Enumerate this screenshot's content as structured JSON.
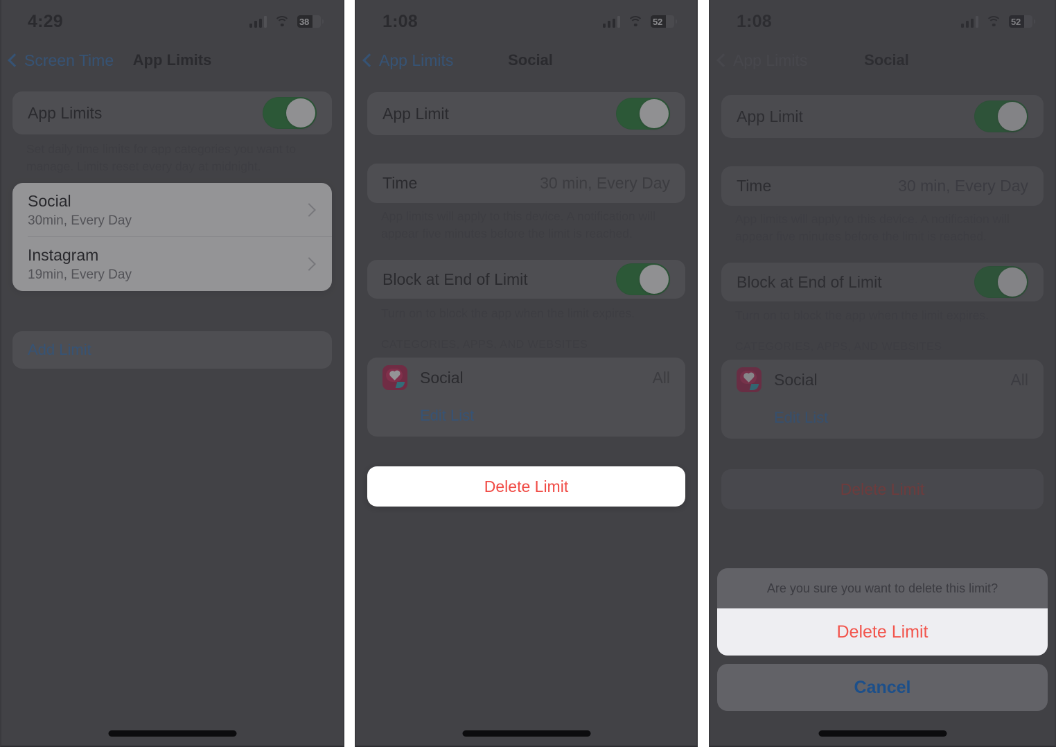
{
  "panels": [
    {
      "status": {
        "time": "4:29",
        "battery_level": "38",
        "signal_icon": "cellular-signal-icon",
        "wifi_icon": "wifi-icon",
        "battery_icon": "battery-icon"
      },
      "nav": {
        "back_label": "Screen Time",
        "title": "App Limits",
        "back_icon": "chevron-left-icon"
      },
      "app_limits_row": {
        "label": "App Limits",
        "toggle_on": true
      },
      "footnote": "Set daily time limits for app categories you want to manage. Limits reset every day at midnight.",
      "limits": [
        {
          "title": "Social",
          "subtitle": "30min, Every Day",
          "chevron_icon": "chevron-right-icon"
        },
        {
          "title": "Instagram",
          "subtitle": "19min, Every Day",
          "chevron_icon": "chevron-right-icon"
        }
      ],
      "add_limit_label": "Add Limit"
    },
    {
      "status": {
        "time": "1:08",
        "battery_level": "52"
      },
      "nav": {
        "back_label": "App Limits",
        "title": "Social"
      },
      "app_limit_row": {
        "label": "App Limit",
        "toggle_on": true
      },
      "time_row": {
        "label": "Time",
        "value": "30 min, Every Day"
      },
      "time_footnote": "App limits will apply to this device. A notification will appear five minutes before the limit is reached.",
      "block_row": {
        "label": "Block at End of Limit",
        "toggle_on": true
      },
      "block_footnote": "Turn on to block the app when the limit expires.",
      "section_header": "CATEGORIES, APPS, AND WEBSITES",
      "category": {
        "name": "Social",
        "value": "All",
        "icon": "social-category-icon"
      },
      "edit_list_label": "Edit List",
      "delete_label": "Delete Limit"
    },
    {
      "status": {
        "time": "1:08",
        "battery_level": "52"
      },
      "nav": {
        "back_label": "App Limits",
        "title": "Social"
      },
      "app_limit_row": {
        "label": "App Limit",
        "toggle_on": true
      },
      "time_row": {
        "label": "Time",
        "value": "30 min, Every Day"
      },
      "time_footnote": "App limits will apply to this device. A notification will appear five minutes before the limit is reached.",
      "block_row": {
        "label": "Block at End of Limit",
        "toggle_on": true
      },
      "block_footnote": "Turn on to block the app when the limit expires.",
      "section_header": "CATEGORIES, APPS, AND WEBSITES",
      "category": {
        "name": "Social",
        "value": "All",
        "icon": "social-category-icon"
      },
      "edit_list_label": "Edit List",
      "delete_label": "Delete Limit",
      "action_sheet": {
        "message": "Are you sure you want to delete this limit?",
        "destructive_label": "Delete Limit",
        "cancel_label": "Cancel"
      }
    }
  ],
  "colors": {
    "accent_blue": "#2f6fb5",
    "destructive_red": "#f04a44",
    "toggle_green": "#1a7a2e",
    "screen_bg": "#4a4a4e",
    "card_white": "#ffffff"
  }
}
